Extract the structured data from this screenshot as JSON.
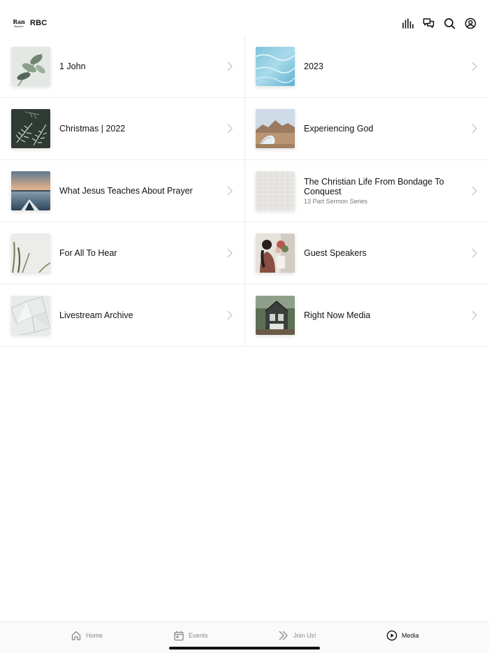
{
  "header": {
    "logo_main": "Ran",
    "logo_sub": "Baptist",
    "title": "RBC",
    "icons": [
      "audio-bars-icon",
      "chat-icon",
      "search-icon",
      "account-icon"
    ]
  },
  "collections": [
    {
      "title": "1 John",
      "subtitle": "",
      "thumb": "eucalyptus-leaves"
    },
    {
      "title": "2023",
      "subtitle": "",
      "thumb": "blue-water"
    },
    {
      "title": "Christmas | 2022",
      "subtitle": "",
      "thumb": "pine-branches"
    },
    {
      "title": "Experiencing God",
      "subtitle": "",
      "thumb": "desert-tent"
    },
    {
      "title": "What Jesus Teaches About Prayer",
      "subtitle": "",
      "thumb": "kayak-lake"
    },
    {
      "title": "The Christian Life From Bondage To Conquest",
      "subtitle": "13 Part Sermon Series",
      "thumb": "white-texture"
    },
    {
      "title": "For All To Hear",
      "subtitle": "",
      "thumb": "grass-blades"
    },
    {
      "title": "Guest Speakers",
      "subtitle": "",
      "thumb": "woman-flowers"
    },
    {
      "title": "Livestream Archive",
      "subtitle": "",
      "thumb": "broken-glass"
    },
    {
      "title": "Right Now Media",
      "subtitle": "",
      "thumb": "cabin"
    }
  ],
  "tabs": [
    {
      "label": "Home",
      "icon": "home-icon",
      "active": false
    },
    {
      "label": "Events",
      "icon": "calendar-icon",
      "active": false
    },
    {
      "label": "Join Us!",
      "icon": "double-chevron-icon",
      "active": false
    },
    {
      "label": "Media",
      "icon": "play-circle-icon",
      "active": true
    }
  ],
  "colors": {
    "text": "#111111",
    "muted": "#888888",
    "divider": "#ececec",
    "tabbar_bg": "#fafafa"
  }
}
